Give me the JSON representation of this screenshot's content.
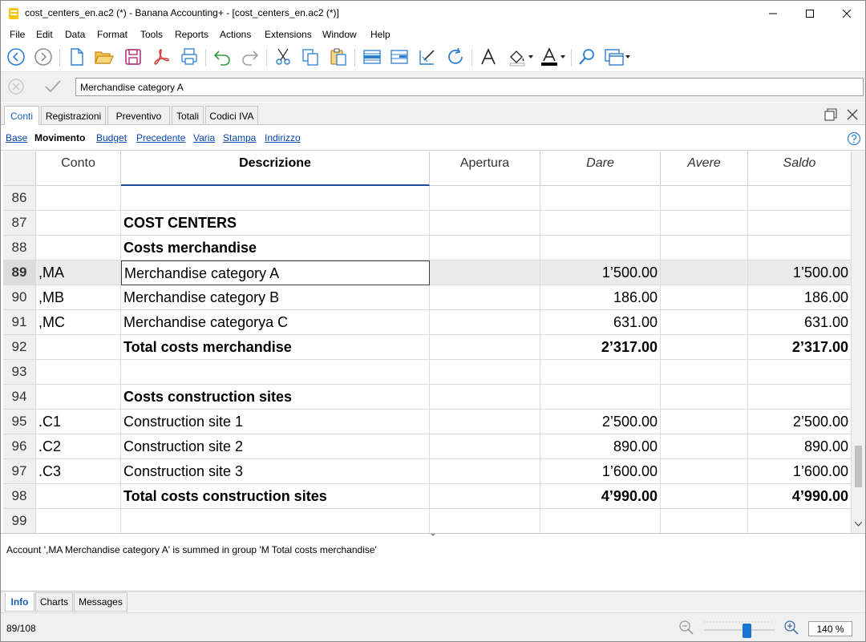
{
  "window": {
    "title": "cost_centers_en.ac2 (*) - Banana Accounting+ - [cost_centers_en.ac2 (*)]",
    "minimize_icon": "minimize-icon",
    "maximize_icon": "maximize-icon",
    "close_icon": "close-icon"
  },
  "menu": [
    "File",
    "Edit",
    "Data",
    "Format",
    "Tools",
    "Reports",
    "Actions",
    "Extensions",
    "Window",
    "Help"
  ],
  "toolbar": {
    "icons": [
      "back-icon",
      "forward-icon",
      "new-file-icon",
      "open-folder-icon",
      "save-icon",
      "pdf-icon",
      "print-icon",
      "undo-icon",
      "redo-icon",
      "cut-icon",
      "copy-icon",
      "paste-icon",
      "insert-rows-icon",
      "add-row-icon",
      "edit-icon",
      "recalculate-icon",
      "font-icon",
      "fill-color-icon",
      "text-color-icon",
      "search-icon",
      "window-layout-icon"
    ]
  },
  "edit_row": {
    "cell_value": "Merchandise category A"
  },
  "tabs": [
    "Conti",
    "Registrazioni",
    "Preventivo",
    "Totali",
    "Codici IVA"
  ],
  "active_tab": "Conti",
  "views": [
    "Base",
    "Movimento",
    "Budget",
    "Precedente",
    "Varia",
    "Stampa",
    "Indirizzo"
  ],
  "active_view": "Movimento",
  "columns": {
    "conto": "Conto",
    "descrizione": "Descrizione",
    "apertura": "Apertura",
    "dare": "Dare",
    "avere": "Avere",
    "saldo": "Saldo"
  },
  "rows": [
    {
      "n": "86",
      "conto": "",
      "desc": "",
      "apertura": "",
      "dare": "",
      "avere": "",
      "saldo": "",
      "bold": false
    },
    {
      "n": "87",
      "conto": "",
      "desc": "COST CENTERS",
      "apertura": "",
      "dare": "",
      "avere": "",
      "saldo": "",
      "bold": true
    },
    {
      "n": "88",
      "conto": "",
      "desc": "Costs merchandise",
      "apertura": "",
      "dare": "",
      "avere": "",
      "saldo": "",
      "bold": true
    },
    {
      "n": "89",
      "conto": ",MA",
      "desc": "Merchandise category A",
      "apertura": "",
      "dare": "1’500.00",
      "avere": "",
      "saldo": "1’500.00",
      "bold": false
    },
    {
      "n": "90",
      "conto": ",MB",
      "desc": "Merchandise category B",
      "apertura": "",
      "dare": "186.00",
      "avere": "",
      "saldo": "186.00",
      "bold": false
    },
    {
      "n": "91",
      "conto": ",MC",
      "desc": "Merchandise categorya C",
      "apertura": "",
      "dare": "631.00",
      "avere": "",
      "saldo": "631.00",
      "bold": false
    },
    {
      "n": "92",
      "conto": "",
      "desc": "Total costs merchandise",
      "apertura": "",
      "dare": "2’317.00",
      "avere": "",
      "saldo": "2’317.00",
      "bold": true
    },
    {
      "n": "93",
      "conto": "",
      "desc": "",
      "apertura": "",
      "dare": "",
      "avere": "",
      "saldo": "",
      "bold": false
    },
    {
      "n": "94",
      "conto": "",
      "desc": "Costs construction sites",
      "apertura": "",
      "dare": "",
      "avere": "",
      "saldo": "",
      "bold": true
    },
    {
      "n": "95",
      "conto": ".C1",
      "desc": "Construction site 1",
      "apertura": "",
      "dare": "2’500.00",
      "avere": "",
      "saldo": "2’500.00",
      "bold": false
    },
    {
      "n": "96",
      "conto": ".C2",
      "desc": "Construction site 2",
      "apertura": "",
      "dare": "890.00",
      "avere": "",
      "saldo": "890.00",
      "bold": false
    },
    {
      "n": "97",
      "conto": ".C3",
      "desc": "Construction site 3",
      "apertura": "",
      "dare": "1’600.00",
      "avere": "",
      "saldo": "1’600.00",
      "bold": false
    },
    {
      "n": "98",
      "conto": "",
      "desc": "Total costs construction sites",
      "apertura": "",
      "dare": "4’990.00",
      "avere": "",
      "saldo": "4’990.00",
      "bold": true
    },
    {
      "n": "99",
      "conto": "",
      "desc": "",
      "apertura": "",
      "dare": "",
      "avere": "",
      "saldo": "",
      "bold": false
    }
  ],
  "selected_row": "89",
  "info": {
    "message": "Account ',MA Merchandise category A' is summed in group 'M Total costs merchandise'"
  },
  "bottom_tabs": [
    "Info",
    "Charts",
    "Messages"
  ],
  "active_bottom_tab": "Info",
  "status": {
    "position": "89/108",
    "zoom": "140 %",
    "zoom_level_percent": 140
  },
  "colors": {
    "accent": "#1a5fb4",
    "link": "#0645ad",
    "selected_row": "#ebebeb",
    "toolbar_blue": "#2d7fd3",
    "pdf_red": "#d83b3b",
    "save_magenta": "#b0327b"
  }
}
